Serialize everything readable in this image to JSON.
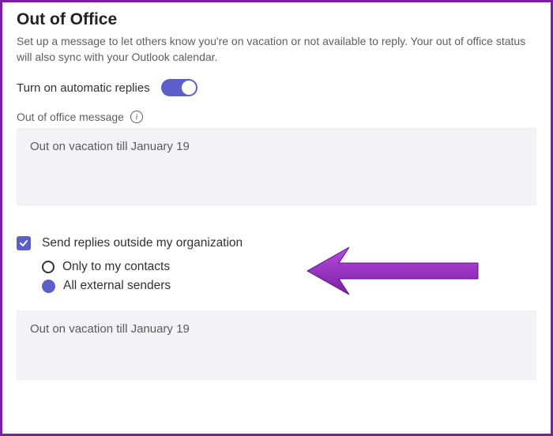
{
  "page": {
    "title": "Out of Office",
    "description": "Set up a message to let others know you're on vacation or not available to reply. Your out of office status will also sync with your Outlook calendar."
  },
  "autoReplies": {
    "label": "Turn on automatic replies",
    "enabled": true
  },
  "internalMessage": {
    "label": "Out of office message",
    "value": "Out on vacation till January 19"
  },
  "externalReplies": {
    "checkboxLabel": "Send replies outside my organization",
    "checked": true,
    "options": {
      "contacts": "Only to my contacts",
      "all": "All external senders"
    },
    "selected": "all"
  },
  "externalMessage": {
    "value": "Out on vacation till January 19"
  },
  "icons": {
    "info": "i"
  }
}
